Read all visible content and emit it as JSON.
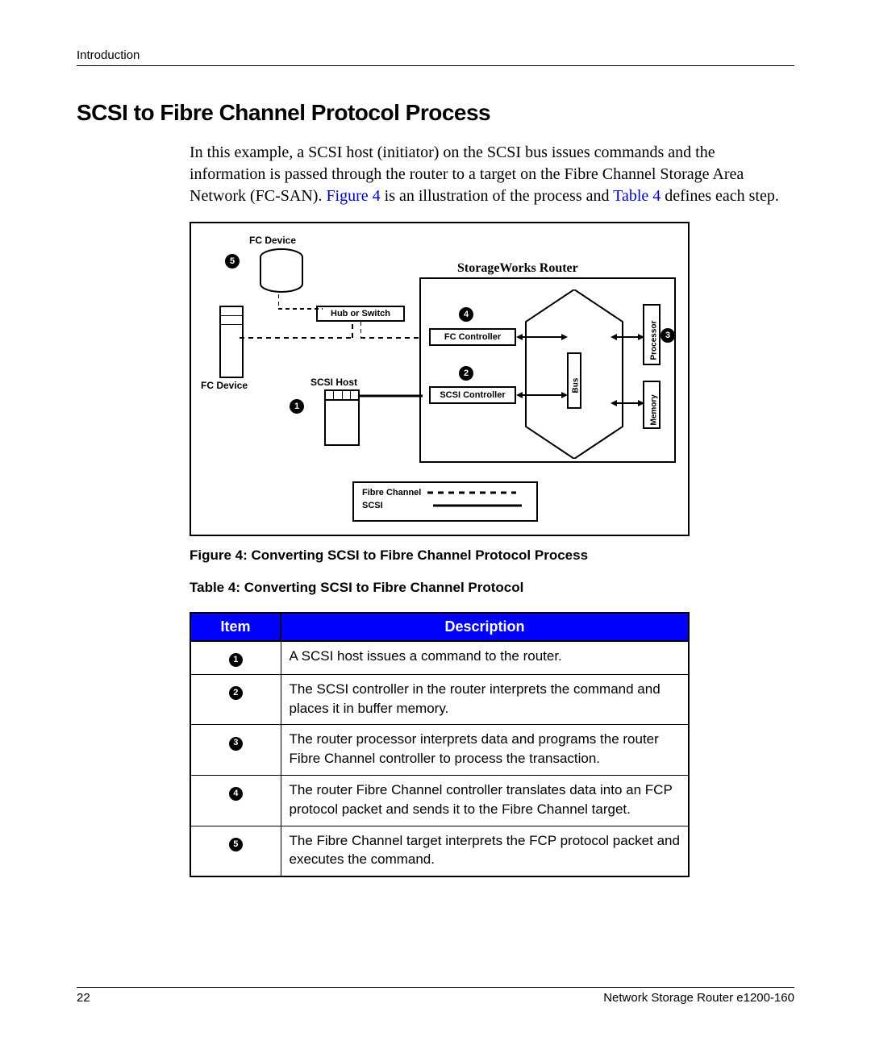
{
  "header": {
    "running": "Introduction"
  },
  "section": {
    "title": "SCSI to Fibre Channel Protocol Process"
  },
  "para": {
    "p1a": "In this example, a SCSI host (initiator) on the SCSI bus issues commands and the information is passed through the router to a target on the Fibre Channel Storage Area Network (FC-SAN). ",
    "fig_ref": "Figure 4",
    "p1b": " is an illustration of the process and ",
    "tab_ref": "Table 4",
    "p1c": " defines each step."
  },
  "figure": {
    "caption": "Figure 4:  Converting SCSI to Fibre Channel Protocol Process",
    "labels": {
      "fc_device_top": "FC Device",
      "fc_device_left": "FC Device",
      "hub_switch": "Hub or Switch",
      "scsi_host": "SCSI Host",
      "router": "StorageWorks Router",
      "fc_controller": "FC Controller",
      "scsi_controller": "SCSI Controller",
      "bus": "Bus",
      "processor": "Processor",
      "memory": "Memory",
      "legend_fc": "Fibre Channel",
      "legend_scsi": "SCSI"
    },
    "callouts": {
      "n1": "1",
      "n2": "2",
      "n3": "3",
      "n4": "4",
      "n5": "5"
    }
  },
  "table": {
    "caption": "Table 4:  Converting SCSI to Fibre Channel Protocol",
    "headers": {
      "item": "Item",
      "desc": "Description"
    },
    "rows": [
      {
        "n": "1",
        "desc": "A SCSI host issues a command to the router."
      },
      {
        "n": "2",
        "desc": "The SCSI controller in the router interprets the command and places it in buffer memory."
      },
      {
        "n": "3",
        "desc": "The router processor interprets data and programs the router Fibre Channel controller to process the transaction."
      },
      {
        "n": "4",
        "desc": "The router Fibre Channel controller translates data into an FCP protocol packet and sends it to the Fibre Channel target."
      },
      {
        "n": "5",
        "desc": "The Fibre Channel target interprets the FCP protocol packet and executes the command."
      }
    ]
  },
  "footer": {
    "page": "22",
    "doc": "Network Storage Router e1200-160"
  }
}
